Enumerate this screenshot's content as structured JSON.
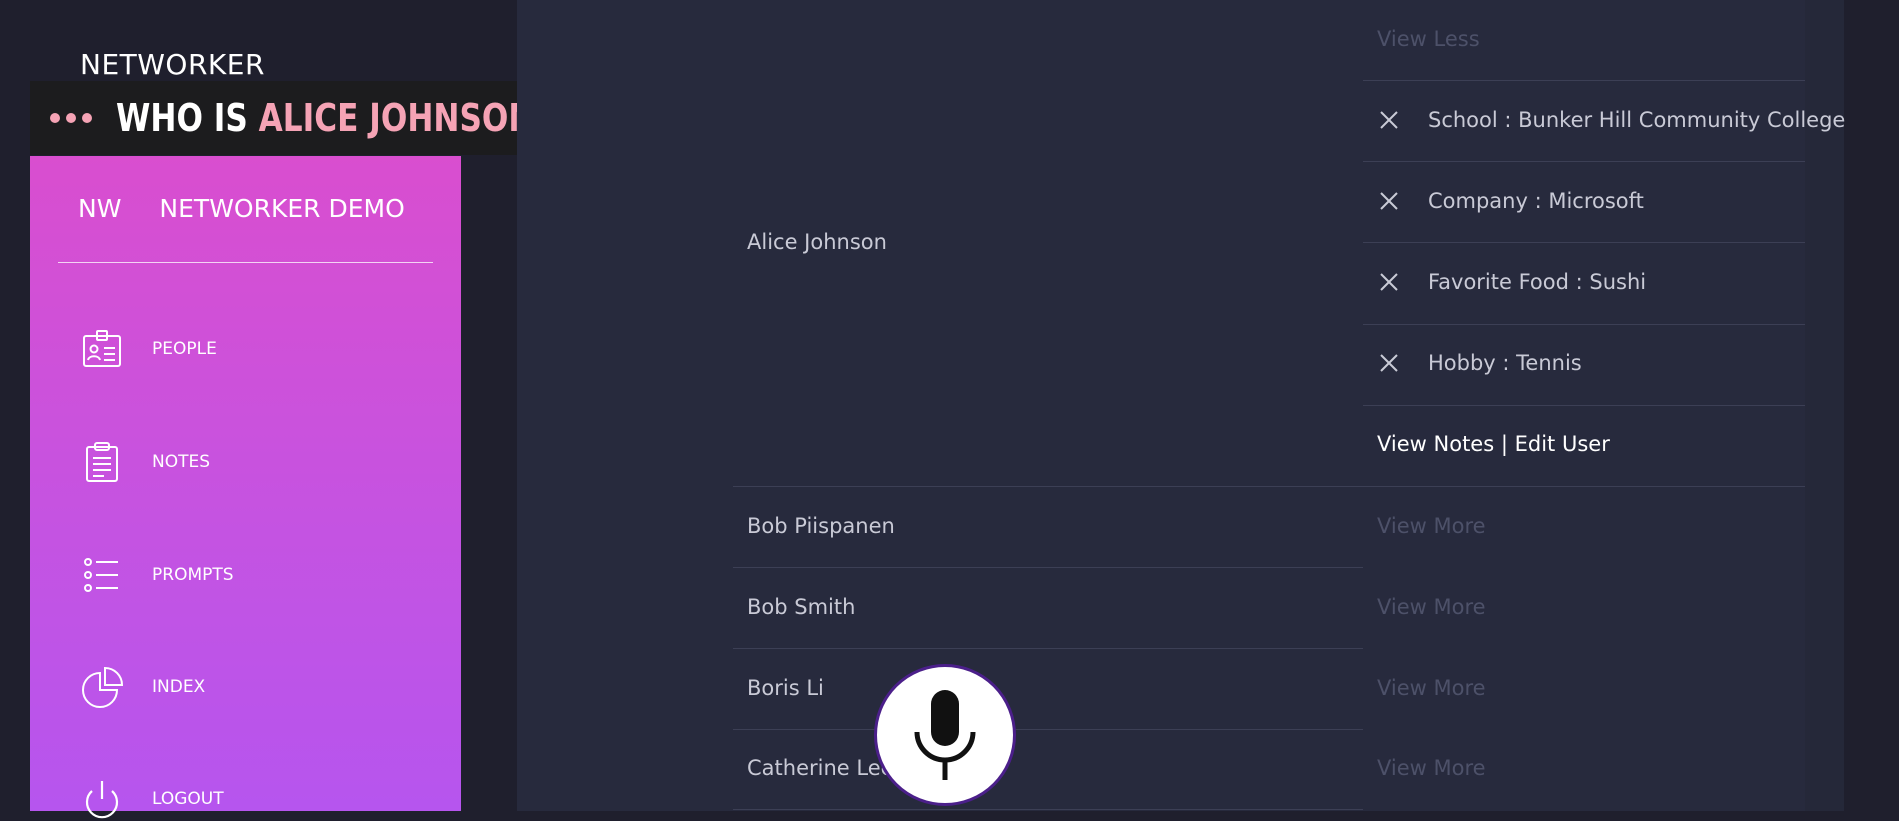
{
  "app": {
    "title": "NETWORKER"
  },
  "query": {
    "prefix": "WHO IS",
    "name": "ALICE JOHNSON"
  },
  "sidebar": {
    "brand_abbr": "NW",
    "brand_name": "NETWORKER DEMO",
    "items": [
      {
        "label": "PEOPLE",
        "icon": "id-card-icon"
      },
      {
        "label": "NOTES",
        "icon": "clipboard-icon"
      },
      {
        "label": "PROMPTS",
        "icon": "list-icon"
      },
      {
        "label": "INDEX",
        "icon": "pie-chart-icon"
      },
      {
        "label": "LOGOUT",
        "icon": "power-icon"
      }
    ]
  },
  "people": {
    "expanded": {
      "name": "Alice Johnson",
      "toggle": "View Less",
      "details": [
        "School : Bunker Hill Community College",
        "Company : Microsoft",
        "Favorite Food : Sushi",
        "Hobby : Tennis"
      ],
      "view_notes": "View Notes",
      "separator": "|",
      "edit_user": "Edit User"
    },
    "rows": [
      {
        "name": "Bob Piispanen",
        "link": "View More"
      },
      {
        "name": "Bob Smith",
        "link": "View More"
      },
      {
        "name": "Boris Li",
        "link": "View More"
      },
      {
        "name": "Catherine Lee",
        "link": "View More"
      }
    ]
  },
  "mic": {
    "icon": "microphone-icon"
  },
  "colors": {
    "accent_pink": "#f5a3b5",
    "sidebar_top": "#d94ecf",
    "sidebar_bottom": "#b655ee",
    "panel": "#272a3d"
  }
}
